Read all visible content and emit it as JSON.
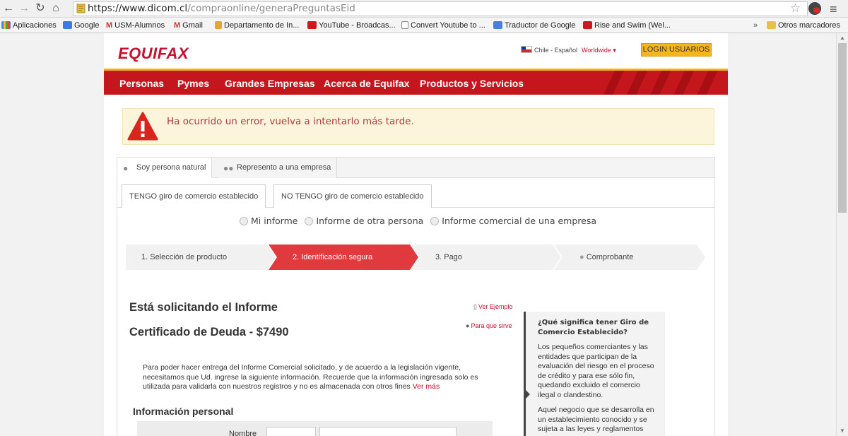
{
  "browser": {
    "url_host": "https://www.dicom.cl",
    "url_path": "/compraonline/generaPreguntasEid",
    "bookmarks": [
      {
        "label": "Aplicaciones",
        "color": "#4285f4"
      },
      {
        "label": "Google",
        "color": "#3a7be6"
      },
      {
        "label": "USM-Alumnos",
        "color": "#c33"
      },
      {
        "label": "Gmail",
        "color": "#c33"
      },
      {
        "label": "Departamento de In...",
        "color": "#e8a23a"
      },
      {
        "label": "YouTube - Broadcas...",
        "color": "#cc181e"
      },
      {
        "label": "Convert Youtube to ...",
        "color": "#888"
      },
      {
        "label": "Traductor de Google",
        "color": "#4a7de0"
      },
      {
        "label": "Rise and Swim (Wel...",
        "color": "#cc181e"
      }
    ],
    "overflow": "»",
    "other_bookmarks": "Otros marcadores"
  },
  "header": {
    "logo": "EQUIFAX",
    "country": "Chile - Español",
    "worldwide": "Worldwide ▾",
    "login": "LOGIN USUARIOS"
  },
  "nav": [
    "Personas",
    "Pymes",
    "Grandes Empresas",
    "Acerca de Equifax",
    "Productos y Servicios"
  ],
  "alert": {
    "message": "Ha ocurrido un error, vuelva a intentarlo más tarde."
  },
  "tabs": {
    "persona": "Soy persona natural",
    "empresa": "Represento a una empresa",
    "tengo": "TENGO giro de comercio establecido",
    "no_tengo": "NO TENGO giro de comercio establecido"
  },
  "radios": [
    "Mi informe",
    "Informe de otra persona",
    "Informe comercial de una empresa"
  ],
  "steps": [
    "1. Selección de producto",
    "2. Identificación segura",
    "3. Pago",
    "Comprobante"
  ],
  "content": {
    "requesting": "Está solicitando el Informe",
    "certificate": "Certificado de Deuda - $7490",
    "ver_ejemplo": "Ver Ejemplo",
    "para_que": "Para que sirve",
    "paragraph": "Para poder hacer entrega del Informe Comercial solicitado, y de acuerdo a la legislación vigente, necesitamos que Ud. ingrese la siguiente información. Recuerde que la información ingresada solo es utilizada para validarla con nuestros registros y no es almacenada con otros fines",
    "ver_mas": "Ver más",
    "personal_info": "Información personal",
    "nombre_label": "Nombre"
  },
  "side": {
    "title": "¿Qué significa tener Giro de Comercio Establecido?",
    "p1": "Los pequeños comerciantes y las entidades que participan de la evaluación del riesgo en el proceso de crédito y para ese sólo fin, quedando excluido el comercio ilegal o clandestino.",
    "p2": "Aquel negocio que se desarrolla en un establecimiento conocido y se sujeta a las leyes y reglamentos"
  }
}
